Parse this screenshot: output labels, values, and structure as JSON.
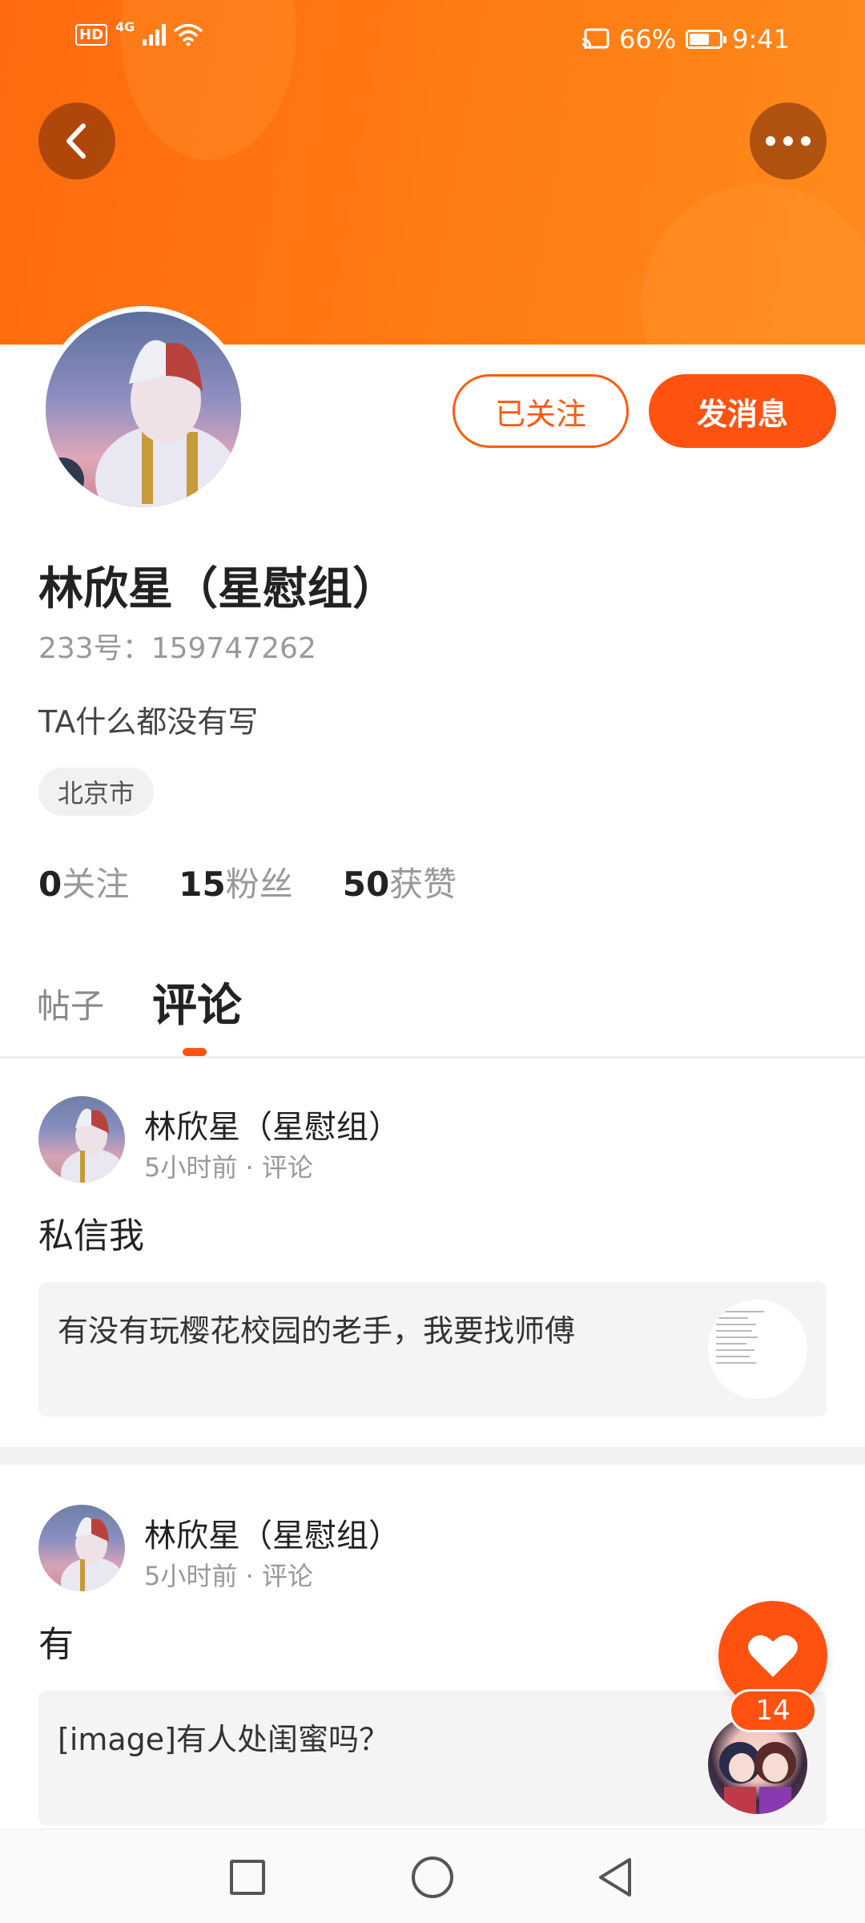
{
  "status_bar": {
    "hd": "HD",
    "network": "4G",
    "battery_percent": "66%",
    "battery_level": 0.66,
    "time": "9:41"
  },
  "header": {
    "back_icon": "chevron-left-icon",
    "more_icon": "more-dots-icon",
    "banner_color": "#ff7a12"
  },
  "profile": {
    "name": "林欣星（星慰组）",
    "id_text": "233号：159747262",
    "bio": "TA什么都没有写",
    "location": "北京市",
    "followed_label": "已关注",
    "message_label": "发消息",
    "stats": [
      {
        "num": "0",
        "label": "关注"
      },
      {
        "num": "15",
        "label": "粉丝"
      },
      {
        "num": "50",
        "label": "获赞"
      }
    ]
  },
  "tabs": {
    "posts": "帖子",
    "comments": "评论",
    "active": "comments"
  },
  "comments": [
    {
      "author": "林欣星（星慰组）",
      "meta": "5小时前 · 评论",
      "text": "私信我",
      "quote": "有没有玩樱花校园的老手，我要找师傅"
    },
    {
      "author": "林欣星（星慰组）",
      "meta": "5小时前 · 评论",
      "text": "有",
      "quote": "[image]有人处闺蜜吗？"
    }
  ],
  "fab": {
    "icon": "heart-icon",
    "count": "14"
  },
  "accent_color": "#ff5210",
  "nav": {
    "recent_icon": "square-icon",
    "home_icon": "circle-icon",
    "back_icon": "triangle-back-icon"
  }
}
